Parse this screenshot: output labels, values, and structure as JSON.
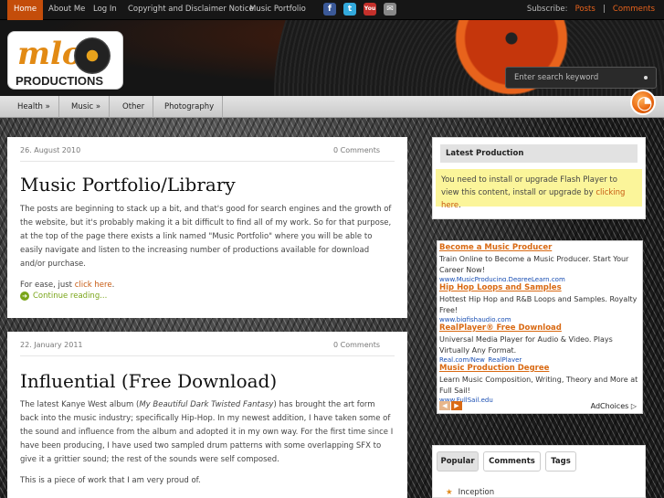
{
  "topnav": {
    "items": [
      "Home",
      "About Me",
      "Log In",
      "Copyright and Disclaimer Notice",
      "Music Portfolio"
    ]
  },
  "social": {
    "facebook": "f",
    "twitter": "t",
    "youtube": "You",
    "email": "✉"
  },
  "subscribe": {
    "label": "Subscribe:",
    "posts": "Posts",
    "sep": "|",
    "comments": "Comments"
  },
  "logo": {
    "letters": "mlo",
    "text": "PRODUCTIONS"
  },
  "search": {
    "placeholder": "Enter search keyword"
  },
  "menu": {
    "items": [
      "Health »",
      "Music »",
      "Other",
      "Photography"
    ]
  },
  "posts": [
    {
      "date": "26. August 2010",
      "comments": "0 Comments",
      "title": "Music Portfolio/Library",
      "p1": "The posts are beginning to stack up a bit, and that's good for search engines and the growth of the website, but it's probably making it a bit difficult to find all of my work. So for that purpose, at the top of the page there exists a link named \"Music Portfolio\" where you will be able to easily navigate and listen to the increasing number of productions available for download and/or purchase.",
      "p2_pre": "For ease, just ",
      "p2_link": "click here",
      "p2_post": ".",
      "continue": "Continue reading..."
    },
    {
      "date": "22. January 2011",
      "comments": "0 Comments",
      "title": "Influential (Free Download)",
      "p1_a": "The latest Kanye West album (",
      "p1_em": "My Beautiful Dark Twisted Fantasy",
      "p1_b": ") has brought the art form back into the music industry; specifically Hip-Hop. In my newest addition, I have taken some of the sound and influence from the album and adopted it in my own way. For the first time since I have been producing, I have used two sampled drum patterns with some overlapping SFX to give it a grittier sound; the rest of the sounds were self composed.",
      "p2": "This is a piece of work that I am very proud of."
    }
  ],
  "sidebar": {
    "latest_title": "Latest Production",
    "flash_pre": "You need to install or upgrade Flash Player to view this content, install or upgrade by ",
    "flash_link": "clicking here",
    "flash_post": ".",
    "ads": [
      {
        "title": "Become a Music Producer",
        "desc": "Train Online to Become a Music Producer. Start Your Career Now!",
        "url": "www.MusicProducing.DegreeLearn.com"
      },
      {
        "title": "Hip Hop Loops and Samples",
        "desc": "Hottest Hip Hop and R&B Loops and Samples. Royalty Free!",
        "url": "www.bigfishaudio.com"
      },
      {
        "title": "RealPlayer® Free Download",
        "desc": "Universal Media Player for Audio & Video. Plays Virtually Any Format.",
        "url": "Real.com/New_RealPlayer"
      },
      {
        "title": "Music Production Degree",
        "desc": "Learn Music Composition, Writing, Theory and More at Full Sail!",
        "url": "www.FullSail.edu"
      }
    ],
    "adchoices": "AdChoices ▷",
    "tabs": [
      "Popular",
      "Comments",
      "Tags"
    ],
    "popular_item": "Inception"
  }
}
